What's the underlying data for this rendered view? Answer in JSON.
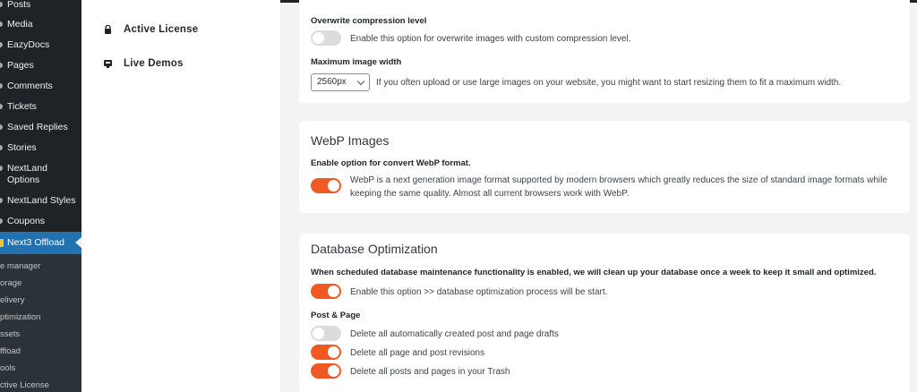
{
  "wp_menu": {
    "items": [
      {
        "label": "Posts"
      },
      {
        "label": "Media"
      },
      {
        "label": "EazyDocs"
      },
      {
        "label": "Pages"
      },
      {
        "label": "Comments"
      },
      {
        "label": "Tickets"
      },
      {
        "label": "Saved Replies"
      },
      {
        "label": "Stories"
      },
      {
        "label": "NextLand"
      },
      {
        "label": "Options"
      },
      {
        "label": "NextLand Styles"
      },
      {
        "label": "Coupons"
      }
    ],
    "active": {
      "label": "Next3 Offload"
    },
    "submenu": [
      {
        "label": "e manager"
      },
      {
        "label": "orage"
      },
      {
        "label": "elivery"
      },
      {
        "label": "ptimization"
      },
      {
        "label": "ssets"
      },
      {
        "label": "ffload"
      },
      {
        "label": "ools"
      },
      {
        "label": "ctive License"
      }
    ]
  },
  "plugin_nav": {
    "items": [
      {
        "label": "Active License",
        "icon": "lock-icon"
      },
      {
        "label": "Live Demos",
        "icon": "monitor-icon"
      }
    ]
  },
  "compression_card": {
    "overwrite_label": "Overwrite compression level",
    "overwrite_desc": "Enable this option for overwrite images with custom compression level.",
    "overwrite_enabled": false,
    "max_width_label": "Maximum image width",
    "max_width_value": "2560px",
    "max_width_desc": "If you often upload or use large images on your website, you might want to start resizing them to fit a maximum width."
  },
  "webp_card": {
    "title": "WebP Images",
    "label": "Enable option for convert WebP format.",
    "desc": "WebP is a next generation image format supported by modern browsers which greatly reduces the size of standard image formats while keeping the same quality. Almost all current browsers work with WebP.",
    "enabled": true
  },
  "db_card": {
    "title": "Database Optimization",
    "label": "When scheduled database maintenance functionality is enabled, we will clean up your database once a week to keep it small and optimized.",
    "enable_desc": "Enable this option >> database optimization process will be start.",
    "enabled": true,
    "post_page_label": "Post & Page",
    "options": [
      {
        "label": "Delete all automatically created post and page drafts",
        "enabled": false
      },
      {
        "label": "Delete all page and post revisions",
        "enabled": true
      },
      {
        "label": "Delete all posts and pages in your Trash",
        "enabled": true
      }
    ]
  },
  "colors": {
    "accent": "#f05a22",
    "wp_active": "#2271b1",
    "wp_sidebar": "#1d2327"
  }
}
